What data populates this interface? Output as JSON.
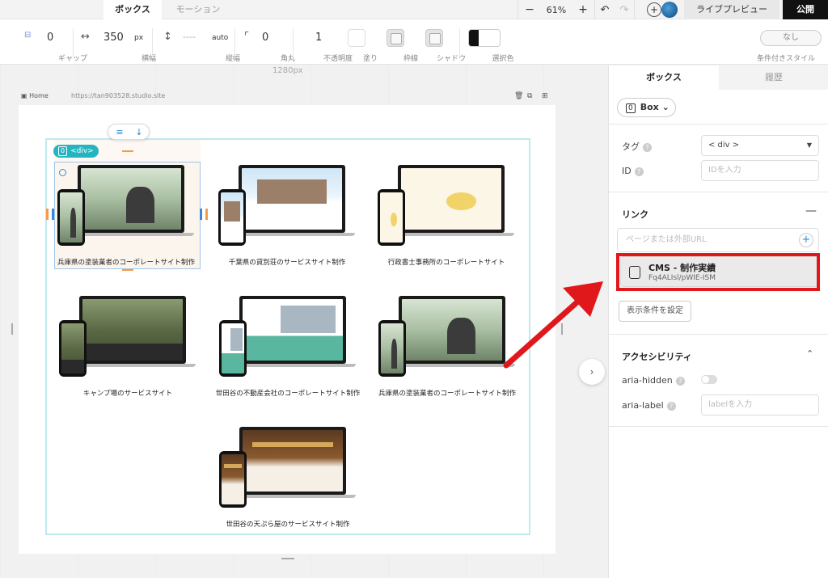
{
  "tabs": {
    "box": "ボックス",
    "motion": "モーション"
  },
  "zoom": {
    "minus": "−",
    "value": "61%",
    "plus": "+",
    "undo": "↶",
    "redo": "↷"
  },
  "header": {
    "add": "+",
    "live_preview": "ライブプレビュー",
    "publish": "公開"
  },
  "props": {
    "gap": {
      "value": "0",
      "label": "ギャップ"
    },
    "width": {
      "value": "350",
      "unit": "px",
      "label": "横幅"
    },
    "height": {
      "value": "----",
      "unit": "auto",
      "label": "縦幅"
    },
    "radius": {
      "value": "0",
      "label": "角丸"
    },
    "opacity": {
      "value": "1",
      "label": "不透明度"
    },
    "fill": {
      "label": "塗り"
    },
    "border": {
      "label": "枠線"
    },
    "shadow": {
      "label": "シャドウ"
    },
    "selection_color": {
      "label": "選択色"
    },
    "conditional": {
      "value": "なし",
      "label": "条件付きスタイル"
    }
  },
  "canvas": {
    "width_label": "1280px",
    "page_name": "Home",
    "page_url": "https://tan903528.studio.site",
    "div_badge": "<div>",
    "div_badge_num": "0",
    "items": [
      {
        "caption": "兵庫県の塗装業者のコーポレートサイト制作",
        "theme": "photo"
      },
      {
        "caption": "千葉県の貸別荘のサービスサイト制作",
        "theme": "sky"
      },
      {
        "caption": "行政書士事務所のコーポレートサイト",
        "theme": "cream"
      },
      {
        "caption": "キャンプ場のサービスサイト",
        "theme": "camp"
      },
      {
        "caption": "世田谷の不動産会社のコーポレートサイト制作",
        "theme": "mint"
      },
      {
        "caption": "兵庫県の塗装業者のコーポレートサイト制作",
        "theme": "photo"
      },
      {
        "caption": "世田谷の天ぷら屋のサービスサイト制作",
        "theme": "wood"
      }
    ]
  },
  "panel": {
    "tab_box": "ボックス",
    "tab_history": "履歴",
    "element": "Box",
    "element_num": "0",
    "tag_label": "タグ",
    "tag_value": "< div >",
    "id_label": "ID",
    "id_placeholder": "IDを入力",
    "link_title": "リンク",
    "link_placeholder": "ページまたは外部URL",
    "cms_title": "CMS - 制作実績",
    "cms_id": "Fq4ALIsl/pWIE-ISM",
    "display_condition": "表示条件を設定",
    "a11y_title": "アクセシビリティ",
    "aria_hidden": "aria-hidden",
    "aria_label": "aria-label",
    "aria_label_placeholder": "labelを入力"
  },
  "colors": {
    "highlight": "#e0181c",
    "accent": "#25b5c1",
    "selection": "#3b88d8"
  }
}
